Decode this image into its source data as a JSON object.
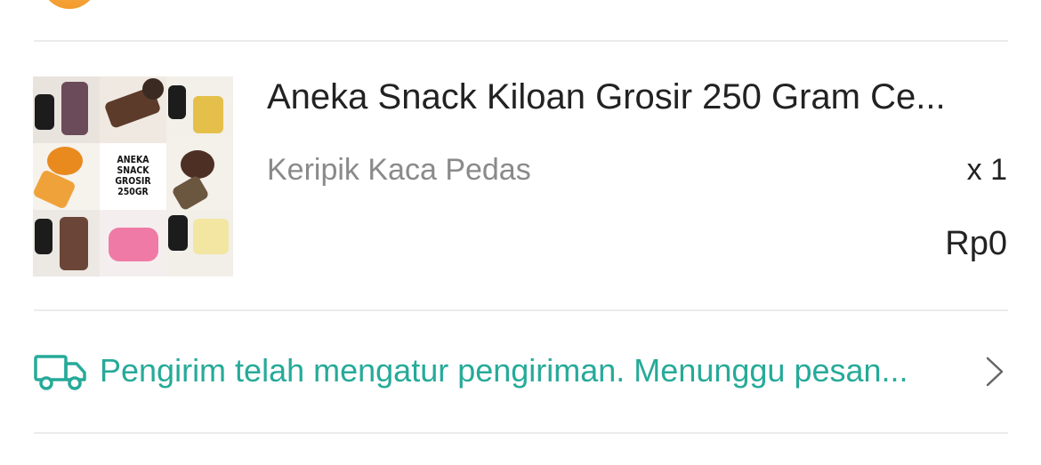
{
  "product": {
    "title": "Aneka Snack Kiloan Grosir 250 Gram Ce...",
    "variant": "Keripik Kaca Pedas",
    "quantity": "x 1",
    "price": "Rp0",
    "image_text": "ANEKA SNACK\nGROSIR\n250GR"
  },
  "shipping": {
    "status": "Pengirim telah mengatur pengiriman. Menunggu pesan...",
    "icon": "truck-icon",
    "accent_color": "#26aa99"
  }
}
